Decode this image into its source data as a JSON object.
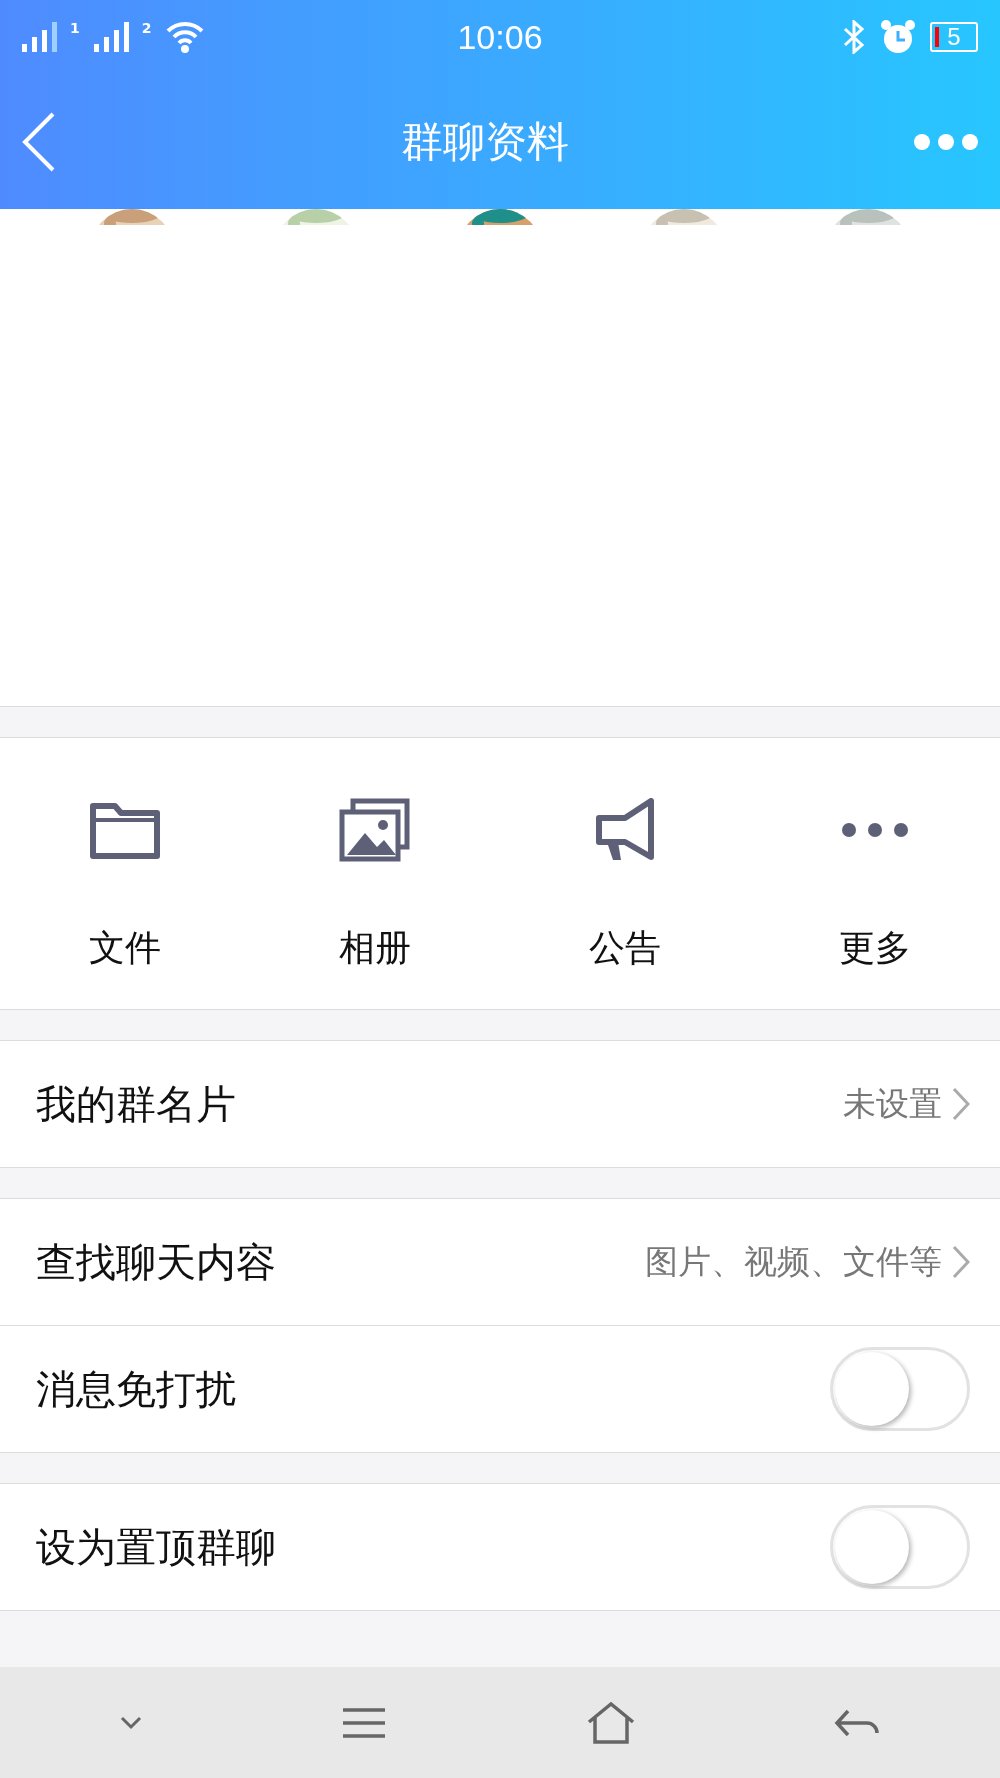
{
  "status_bar": {
    "time": "10:06",
    "sim_labels": [
      "1",
      "2"
    ],
    "battery": "5"
  },
  "header": {
    "title": "群聊资料"
  },
  "members": [
    {
      "kind": "picture"
    },
    {
      "kind": "picture"
    },
    {
      "kind": "picture"
    },
    {
      "kind": "picture"
    },
    {
      "kind": "picture"
    }
  ],
  "shortcuts": [
    {
      "kind": "folder",
      "label": "文件"
    },
    {
      "kind": "album",
      "label": "相册"
    },
    {
      "kind": "notice",
      "label": "公告"
    },
    {
      "kind": "more",
      "label": "更多"
    }
  ],
  "sections": [
    [
      {
        "kind": "link",
        "label": "我的群名片",
        "value": "未设置"
      }
    ],
    [
      {
        "kind": "link",
        "label": "查找聊天内容",
        "value": "图片、视频、文件等"
      },
      {
        "kind": "toggle",
        "label": "消息免打扰",
        "on": false
      }
    ],
    [
      {
        "kind": "toggle",
        "label": "设为置顶群聊",
        "on": false
      }
    ]
  ]
}
